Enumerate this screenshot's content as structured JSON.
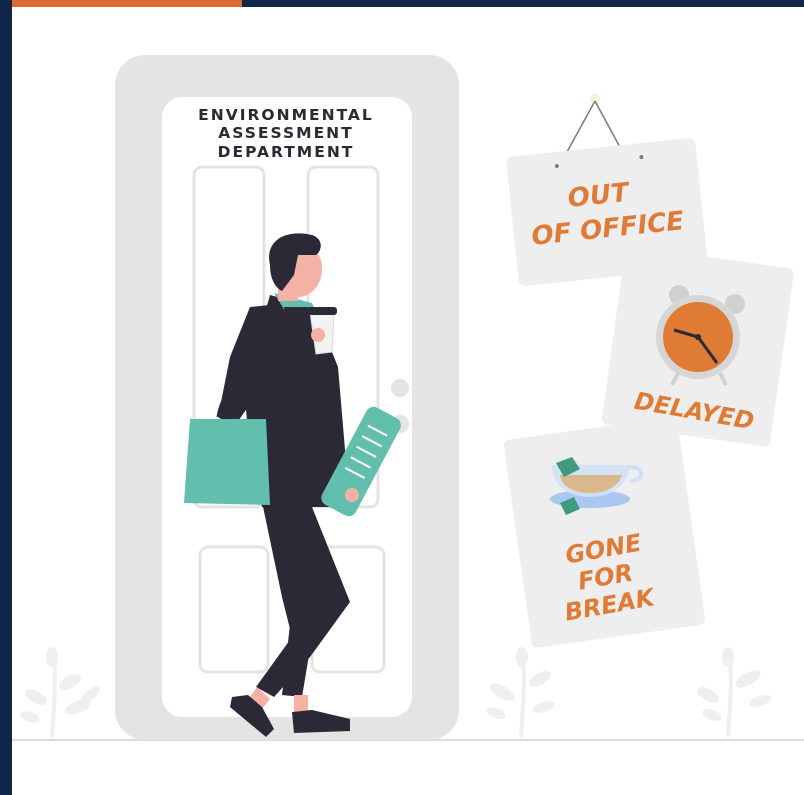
{
  "door": {
    "title_lines": [
      "ENVIRONMENTAL",
      "ASSESSMENT",
      "DEPARTMENT"
    ]
  },
  "signs": {
    "out_of_office": [
      "OUT",
      "OF OFFICE"
    ],
    "delayed": [
      "DELAYED"
    ],
    "gone_for_break": [
      "GONE",
      "FOR",
      "BREAK"
    ]
  },
  "colors": {
    "frame": "#12264a",
    "accent": "#d96a32",
    "sign_text": "#e07b36",
    "teal": "#62bfae",
    "suit": "#2b2935",
    "door": "#e4e4e4"
  },
  "icons": [
    "alarm-clock-icon",
    "teacup-icon",
    "plant-icon"
  ]
}
